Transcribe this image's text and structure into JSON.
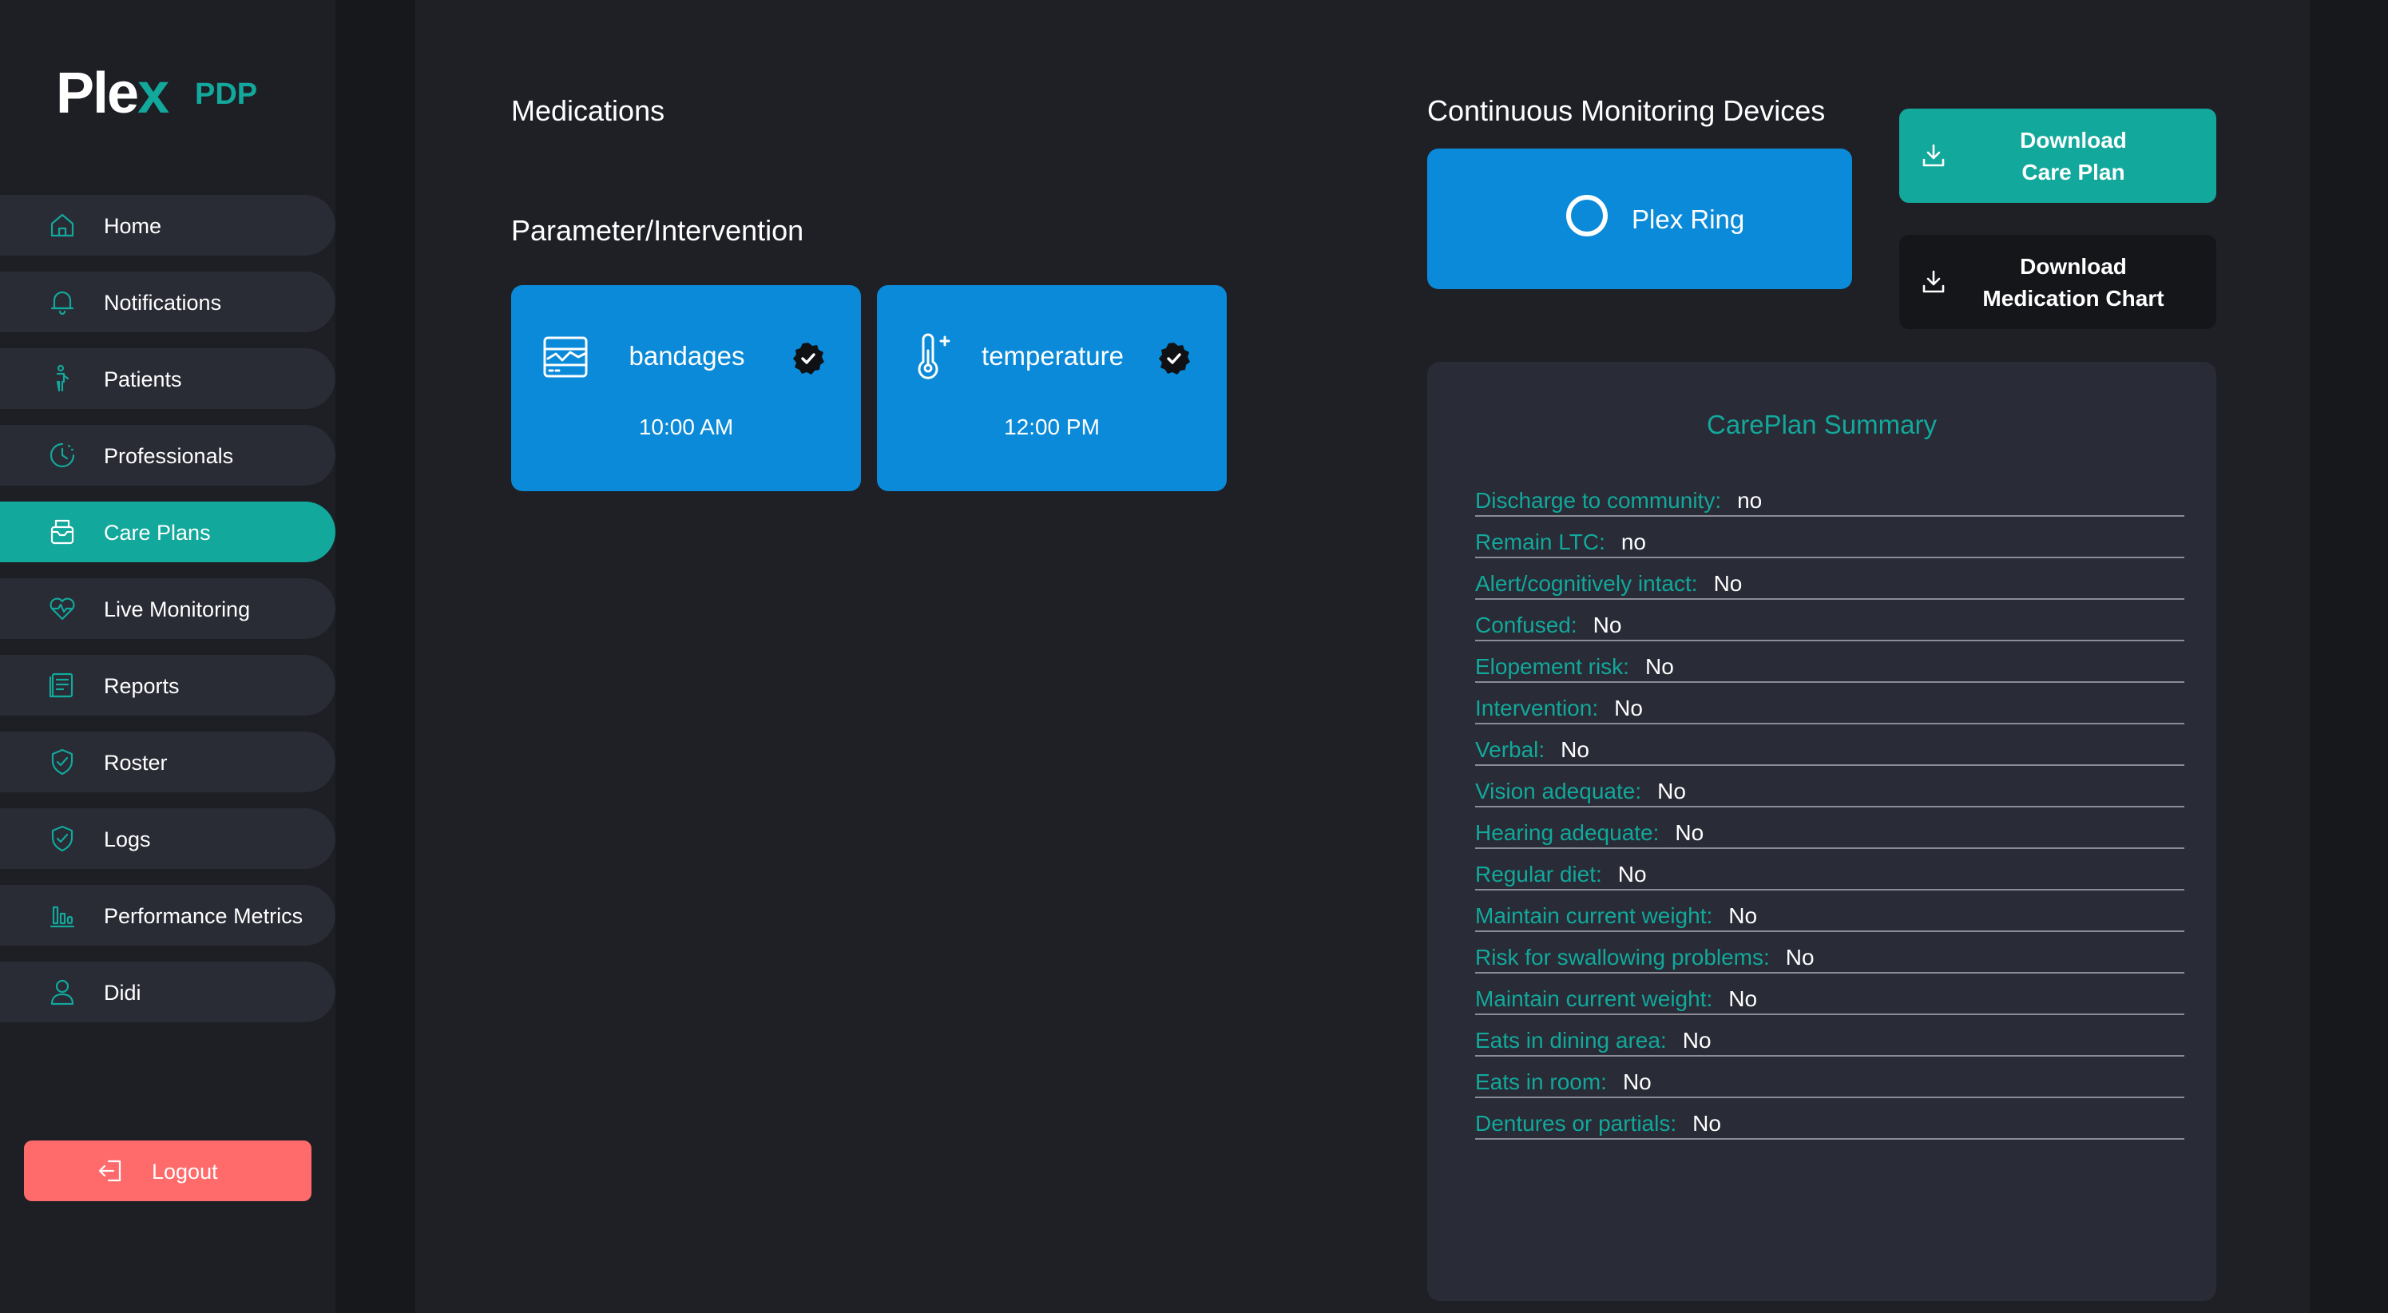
{
  "brand": {
    "logo_main": "Ple",
    "logo_x": "x",
    "logo_sub": "PDP"
  },
  "sidebar": {
    "items": [
      {
        "label": "Home",
        "icon": "home-icon",
        "active": false
      },
      {
        "label": "Notifications",
        "icon": "bell-icon",
        "active": false
      },
      {
        "label": "Patients",
        "icon": "patient-icon",
        "active": false
      },
      {
        "label": "Professionals",
        "icon": "clock-icon",
        "active": false
      },
      {
        "label": "Care Plans",
        "icon": "care-plan-icon",
        "active": true
      },
      {
        "label": "Live Monitoring",
        "icon": "heart-monitor-icon",
        "active": false
      },
      {
        "label": "Reports",
        "icon": "report-icon",
        "active": false
      },
      {
        "label": "Roster",
        "icon": "shield-check-icon",
        "active": false
      },
      {
        "label": "Logs",
        "icon": "shield-check-icon",
        "active": false
      },
      {
        "label": "Performance Metrics",
        "icon": "bar-chart-icon",
        "active": false
      },
      {
        "label": "Didi",
        "icon": "user-icon",
        "active": false
      }
    ],
    "logout_label": "Logout"
  },
  "main": {
    "medications_title": "Medications",
    "parameters_title": "Parameter/Intervention",
    "parameters": [
      {
        "name": "bandages",
        "time": "10:00 AM",
        "icon": "monitor-chart-icon",
        "checked": true
      },
      {
        "name": "temperature",
        "time": "12:00 PM",
        "icon": "thermometer-icon",
        "checked": true
      }
    ],
    "devices_title": "Continuous Monitoring Devices",
    "device": {
      "label": "Plex Ring",
      "icon": "ring-icon"
    },
    "download_care_plan": "Download\nCare Plan",
    "download_medication_chart": "Download\nMedication Chart",
    "summary": {
      "title": "CarePlan Summary",
      "rows": [
        {
          "key": "Discharge to community:",
          "value": "no"
        },
        {
          "key": "Remain LTC:",
          "value": "no"
        },
        {
          "key": "Alert/cognitively intact:",
          "value": "No"
        },
        {
          "key": "Confused:",
          "value": "No"
        },
        {
          "key": "Elopement risk:",
          "value": "No"
        },
        {
          "key": "Intervention:",
          "value": "No"
        },
        {
          "key": "Verbal:",
          "value": "No"
        },
        {
          "key": "Vision adequate:",
          "value": "No"
        },
        {
          "key": "Hearing adequate:",
          "value": "No"
        },
        {
          "key": "Regular diet:",
          "value": "No"
        },
        {
          "key": "Maintain current weight:",
          "value": "No"
        },
        {
          "key": "Risk for swallowing problems:",
          "value": "No"
        },
        {
          "key": "Maintain current weight:",
          "value": "No"
        },
        {
          "key": "Eats in dining area:",
          "value": "No"
        },
        {
          "key": "Eats in room:",
          "value": "No"
        },
        {
          "key": "Dentures or partials:",
          "value": "No"
        }
      ]
    }
  },
  "colors": {
    "accent": "#12a89b",
    "card_blue": "#0a8ad8",
    "logout": "#ff6b6b",
    "bg": "#1f2026"
  }
}
